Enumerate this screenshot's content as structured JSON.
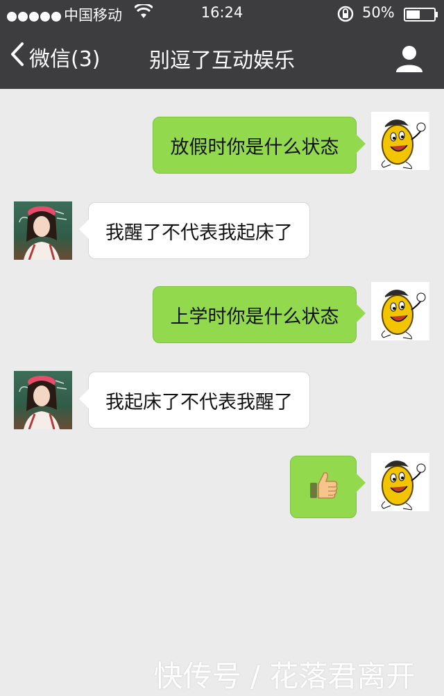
{
  "status_bar": {
    "carrier": "中国移动",
    "time": "16:24",
    "battery_percent": "50%",
    "battery_level": 0.5
  },
  "nav": {
    "back_label": "微信(3)",
    "title": "别逗了互动娱乐"
  },
  "messages": [
    {
      "side": "sent",
      "type": "text",
      "text": "放假时你是什么状态",
      "avatar": "mascot-avatar"
    },
    {
      "side": "received",
      "type": "text",
      "text": "我醒了不代表我起床了",
      "avatar": "girl-avatar"
    },
    {
      "side": "sent",
      "type": "text",
      "text": "上学时你是什么状态",
      "avatar": "mascot-avatar"
    },
    {
      "side": "received",
      "type": "text",
      "text": "我起床了不代表我醒了",
      "avatar": "girl-avatar"
    },
    {
      "side": "sent",
      "type": "emoji",
      "emoji": "thumbs-up-icon",
      "avatar": "mascot-avatar"
    }
  ],
  "watermark": "快传号 / 花落君离开",
  "colors": {
    "header_bg": "#3d3d40",
    "chat_bg": "#ebebeb",
    "sent_bubble": "#93d94e",
    "received_bubble": "#ffffff"
  }
}
